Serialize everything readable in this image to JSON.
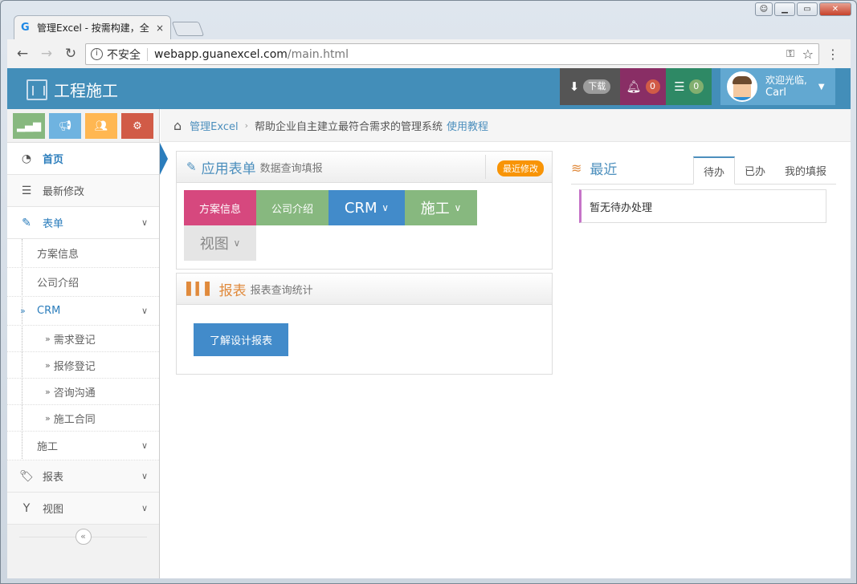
{
  "browser": {
    "tab_title": "管理Excel - 按需构建，全",
    "tab_close": "×",
    "security_label": "不安全",
    "url_host": "webapp.guanexcel.com",
    "url_path": "/main.html"
  },
  "app": {
    "brand": "工程施工",
    "download_label": "下载",
    "notifications_count": "0",
    "tasks_count": "0",
    "welcome": "欢迎光临,",
    "username": "Carl"
  },
  "sidebar": {
    "items": [
      {
        "label": "首页"
      },
      {
        "label": "最新修改"
      },
      {
        "label": "表单"
      },
      {
        "label": "报表"
      },
      {
        "label": "视图"
      }
    ],
    "form_sub": [
      {
        "label": "方案信息"
      },
      {
        "label": "公司介绍"
      },
      {
        "label": "CRM"
      },
      {
        "label": "施工"
      }
    ],
    "crm_sub": [
      {
        "label": "需求登记"
      },
      {
        "label": "报修登记"
      },
      {
        "label": "咨询沟通"
      },
      {
        "label": "施工合同"
      }
    ]
  },
  "breadcrumb": {
    "home": "管理Excel",
    "text": "帮助企业自主建立最符合需求的管理系统",
    "tutorial": "使用教程"
  },
  "forms_widget": {
    "title": "应用表单",
    "subtitle": "数据查询填报",
    "badge": "最近修改",
    "tiles": [
      "方案信息",
      "公司介绍",
      "CRM",
      "施工",
      "视图"
    ]
  },
  "reports_widget": {
    "title": "报表",
    "subtitle": "报表查询统计",
    "button": "了解设计报表"
  },
  "recent": {
    "title": "最近",
    "tabs": [
      "待办",
      "已办",
      "我的填报"
    ],
    "empty": "暂无待办处理"
  },
  "colors": {
    "topbar": "#438eb9",
    "accent": "#4c8fbd",
    "tile_pink": "#d6487e",
    "tile_green": "#87b87f",
    "tile_blue": "#428bca"
  }
}
